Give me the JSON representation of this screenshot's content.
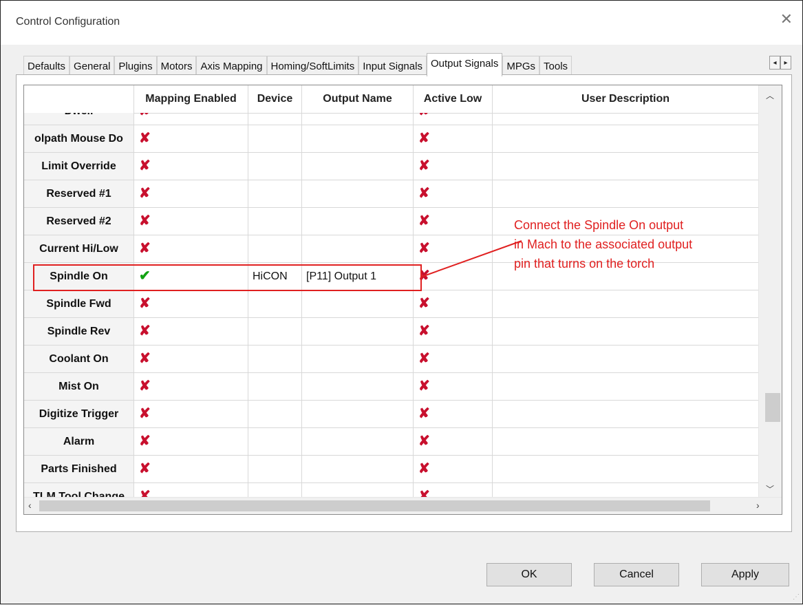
{
  "window": {
    "title": "Control Configuration"
  },
  "tabs": [
    {
      "label": "Defaults"
    },
    {
      "label": "General"
    },
    {
      "label": "Plugins"
    },
    {
      "label": "Motors"
    },
    {
      "label": "Axis Mapping"
    },
    {
      "label": "Homing/SoftLimits"
    },
    {
      "label": "Input Signals"
    },
    {
      "label": "Output Signals",
      "active": true
    },
    {
      "label": "MPGs"
    },
    {
      "label": "Tools"
    }
  ],
  "columns": [
    "",
    "Mapping Enabled",
    "Device",
    "Output Name",
    "Active Low",
    "User Description"
  ],
  "rows": [
    {
      "name": "Dwell",
      "enabled": false,
      "device": "",
      "output": "",
      "active_low": false,
      "description": ""
    },
    {
      "name": "olpath Mouse Do",
      "enabled": false,
      "device": "",
      "output": "",
      "active_low": false,
      "description": ""
    },
    {
      "name": "Limit Override",
      "enabled": false,
      "device": "",
      "output": "",
      "active_low": false,
      "description": ""
    },
    {
      "name": "Reserved #1",
      "enabled": false,
      "device": "",
      "output": "",
      "active_low": false,
      "description": ""
    },
    {
      "name": "Reserved #2",
      "enabled": false,
      "device": "",
      "output": "",
      "active_low": false,
      "description": ""
    },
    {
      "name": "Current Hi/Low",
      "enabled": false,
      "device": "",
      "output": "",
      "active_low": false,
      "description": ""
    },
    {
      "name": "Spindle On",
      "enabled": true,
      "device": "HiCON",
      "output": "[P11] Output 1",
      "active_low": false,
      "description": ""
    },
    {
      "name": "Spindle Fwd",
      "enabled": false,
      "device": "",
      "output": "",
      "active_low": false,
      "description": ""
    },
    {
      "name": "Spindle Rev",
      "enabled": false,
      "device": "",
      "output": "",
      "active_low": false,
      "description": ""
    },
    {
      "name": "Coolant On",
      "enabled": false,
      "device": "",
      "output": "",
      "active_low": false,
      "description": ""
    },
    {
      "name": "Mist On",
      "enabled": false,
      "device": "",
      "output": "",
      "active_low": false,
      "description": ""
    },
    {
      "name": "Digitize Trigger",
      "enabled": false,
      "device": "",
      "output": "",
      "active_low": false,
      "description": ""
    },
    {
      "name": "Alarm",
      "enabled": false,
      "device": "",
      "output": "",
      "active_low": false,
      "description": ""
    },
    {
      "name": "Parts Finished",
      "enabled": false,
      "device": "",
      "output": "",
      "active_low": false,
      "description": ""
    },
    {
      "name": "TLM Tool Change",
      "enabled": false,
      "device": "",
      "output": "",
      "active_low": false,
      "description": ""
    }
  ],
  "annotation": {
    "lines": [
      "Connect the Spindle On output",
      "in Mach to the associated output",
      "pin that turns on the torch"
    ],
    "color": "#e02020"
  },
  "icons": {
    "disabled": "red-x-icon",
    "enabled": "green-check-icon"
  },
  "buttons": {
    "ok": "OK",
    "cancel": "Cancel",
    "apply": "Apply"
  }
}
